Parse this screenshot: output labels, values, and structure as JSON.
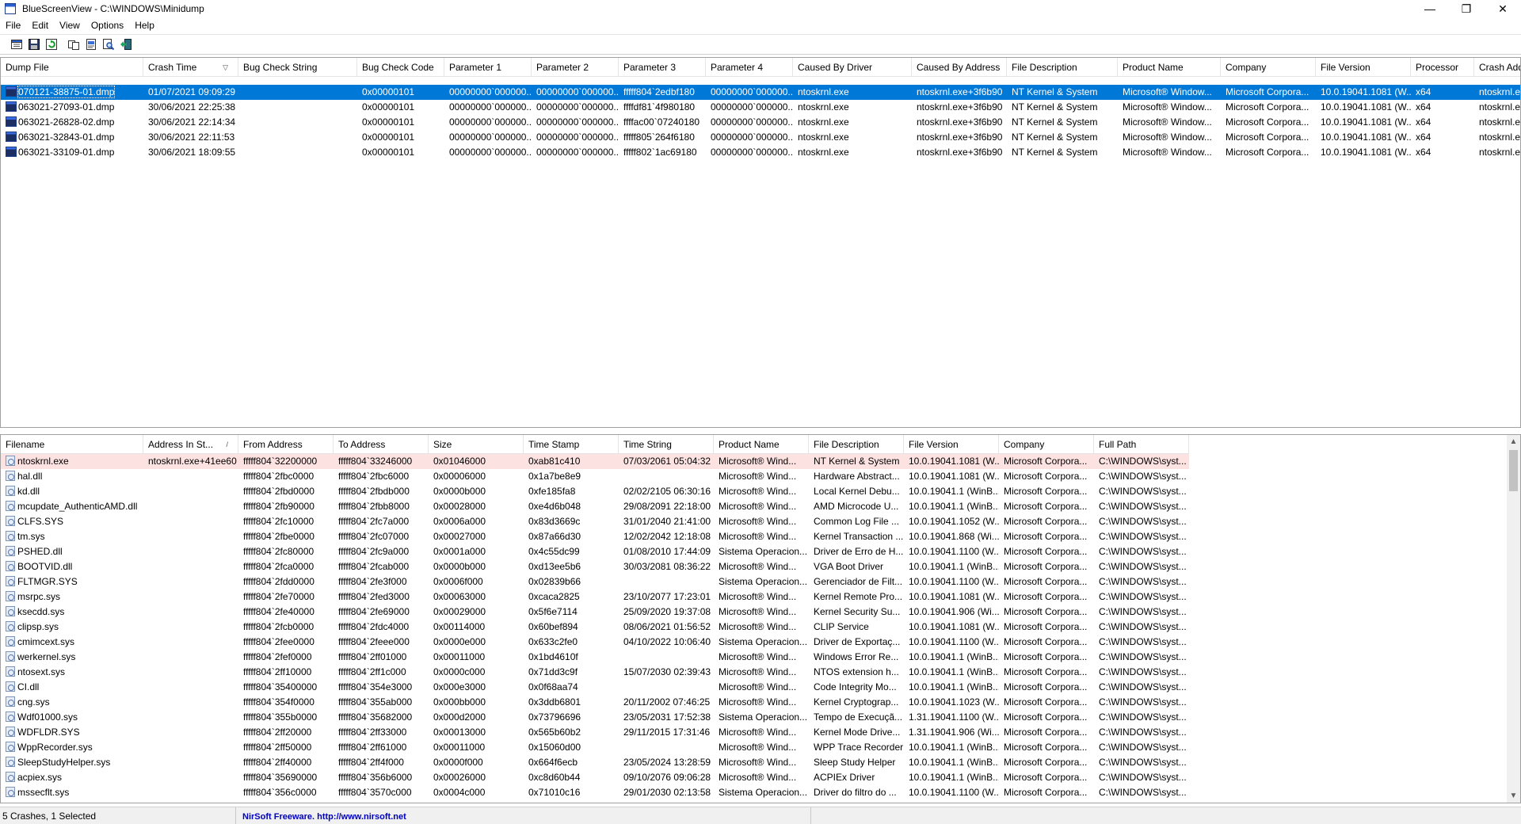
{
  "window": {
    "title": "BlueScreenView  -  C:\\WINDOWS\\Minidump",
    "minimize_glyph": "—",
    "maximize_glyph": "❐",
    "close_glyph": "✕"
  },
  "menu": [
    "File",
    "Edit",
    "View",
    "Options",
    "Help"
  ],
  "toolbar": [
    "properties-icon",
    "save-icon",
    "refresh-icon",
    "copy-icon",
    "html-report-icon",
    "find-icon",
    "exit-icon"
  ],
  "upper": {
    "columns": [
      "Dump File",
      "Crash Time",
      "Bug Check String",
      "Bug Check Code",
      "Parameter 1",
      "Parameter 2",
      "Parameter 3",
      "Parameter 4",
      "Caused By Driver",
      "Caused By Address",
      "File Description",
      "Product Name",
      "Company",
      "File Version",
      "Processor",
      "Crash Add"
    ],
    "sort_glyph": "▽",
    "rows": [
      [
        "070121-38875-01.dmp",
        "01/07/2021 09:09:29",
        "",
        "0x00000101",
        "00000000`000000...",
        "00000000`000000...",
        "fffff804`2edbf180",
        "00000000`000000...",
        "ntoskrnl.exe",
        "ntoskrnl.exe+3f6b90",
        "NT Kernel & System",
        "Microsoft® Window...",
        "Microsoft Corpora...",
        "10.0.19041.1081 (W...",
        "x64",
        "ntoskrnl.e"
      ],
      [
        "063021-27093-01.dmp",
        "30/06/2021 22:25:38",
        "",
        "0x00000101",
        "00000000`000000...",
        "00000000`000000...",
        "ffffdf81`4f980180",
        "00000000`000000...",
        "ntoskrnl.exe",
        "ntoskrnl.exe+3f6b90",
        "NT Kernel & System",
        "Microsoft® Window...",
        "Microsoft Corpora...",
        "10.0.19041.1081 (W...",
        "x64",
        "ntoskrnl.e"
      ],
      [
        "063021-26828-02.dmp",
        "30/06/2021 22:14:34",
        "",
        "0x00000101",
        "00000000`000000...",
        "00000000`000000...",
        "ffffac00`07240180",
        "00000000`000000...",
        "ntoskrnl.exe",
        "ntoskrnl.exe+3f6b90",
        "NT Kernel & System",
        "Microsoft® Window...",
        "Microsoft Corpora...",
        "10.0.19041.1081 (W...",
        "x64",
        "ntoskrnl.e"
      ],
      [
        "063021-32843-01.dmp",
        "30/06/2021 22:11:53",
        "",
        "0x00000101",
        "00000000`000000...",
        "00000000`000000...",
        "fffff805`264f6180",
        "00000000`000000...",
        "ntoskrnl.exe",
        "ntoskrnl.exe+3f6b90",
        "NT Kernel & System",
        "Microsoft® Window...",
        "Microsoft Corpora...",
        "10.0.19041.1081 (W...",
        "x64",
        "ntoskrnl.e"
      ],
      [
        "063021-33109-01.dmp",
        "30/06/2021 18:09:55",
        "",
        "0x00000101",
        "00000000`000000...",
        "00000000`000000...",
        "fffff802`1ac69180",
        "00000000`000000...",
        "ntoskrnl.exe",
        "ntoskrnl.exe+3f6b90",
        "NT Kernel & System",
        "Microsoft® Window...",
        "Microsoft Corpora...",
        "10.0.19041.1081 (W...",
        "x64",
        "ntoskrnl.e"
      ]
    ]
  },
  "lower": {
    "columns": [
      "Filename",
      "Address In St...",
      "From Address",
      "To Address",
      "Size",
      "Time Stamp",
      "Time String",
      "Product Name",
      "File Description",
      "File Version",
      "Company",
      "Full Path"
    ],
    "sort_glyph": "/",
    "rows": [
      [
        "ntoskrnl.exe",
        "ntoskrnl.exe+41ee60",
        "fffff804`32200000",
        "fffff804`33246000",
        "0x01046000",
        "0xab81c410",
        "07/03/2061 05:04:32",
        "Microsoft® Wind...",
        "NT Kernel & System",
        "10.0.19041.1081 (W...",
        "Microsoft Corpora...",
        "C:\\WINDOWS\\syst..."
      ],
      [
        "hal.dll",
        "",
        "fffff804`2fbc0000",
        "fffff804`2fbc6000",
        "0x00006000",
        "0x1a7be8e9",
        "",
        "Microsoft® Wind...",
        "Hardware Abstract...",
        "10.0.19041.1081 (W...",
        "Microsoft Corpora...",
        "C:\\WINDOWS\\syst..."
      ],
      [
        "kd.dll",
        "",
        "fffff804`2fbd0000",
        "fffff804`2fbdb000",
        "0x0000b000",
        "0xfe185fa8",
        "02/02/2105 06:30:16",
        "Microsoft® Wind...",
        "Local Kernel Debu...",
        "10.0.19041.1 (WinB...",
        "Microsoft Corpora...",
        "C:\\WINDOWS\\syst..."
      ],
      [
        "mcupdate_AuthenticAMD.dll",
        "",
        "fffff804`2fb90000",
        "fffff804`2fbb8000",
        "0x00028000",
        "0xe4d6b048",
        "29/08/2091 22:18:00",
        "Microsoft® Wind...",
        "AMD Microcode U...",
        "10.0.19041.1 (WinB...",
        "Microsoft Corpora...",
        "C:\\WINDOWS\\syst..."
      ],
      [
        "CLFS.SYS",
        "",
        "fffff804`2fc10000",
        "fffff804`2fc7a000",
        "0x0006a000",
        "0x83d3669c",
        "31/01/2040 21:41:00",
        "Microsoft® Wind...",
        "Common Log File ...",
        "10.0.19041.1052 (W...",
        "Microsoft Corpora...",
        "C:\\WINDOWS\\syst..."
      ],
      [
        "tm.sys",
        "",
        "fffff804`2fbe0000",
        "fffff804`2fc07000",
        "0x00027000",
        "0x87a66d30",
        "12/02/2042 12:18:08",
        "Microsoft® Wind...",
        "Kernel Transaction ...",
        "10.0.19041.868 (Wi...",
        "Microsoft Corpora...",
        "C:\\WINDOWS\\syst..."
      ],
      [
        "PSHED.dll",
        "",
        "fffff804`2fc80000",
        "fffff804`2fc9a000",
        "0x0001a000",
        "0x4c55dc99",
        "01/08/2010 17:44:09",
        "Sistema Operacion...",
        "Driver de Erro de H...",
        "10.0.19041.1100 (W...",
        "Microsoft Corpora...",
        "C:\\WINDOWS\\syst..."
      ],
      [
        "BOOTVID.dll",
        "",
        "fffff804`2fca0000",
        "fffff804`2fcab000",
        "0x0000b000",
        "0xd13ee5b6",
        "30/03/2081 08:36:22",
        "Microsoft® Wind...",
        "VGA Boot Driver",
        "10.0.19041.1 (WinB...",
        "Microsoft Corpora...",
        "C:\\WINDOWS\\syst..."
      ],
      [
        "FLTMGR.SYS",
        "",
        "fffff804`2fdd0000",
        "fffff804`2fe3f000",
        "0x0006f000",
        "0x02839b66",
        "",
        "Sistema Operacion...",
        "Gerenciador de Filt...",
        "10.0.19041.1100 (W...",
        "Microsoft Corpora...",
        "C:\\WINDOWS\\syst..."
      ],
      [
        "msrpc.sys",
        "",
        "fffff804`2fe70000",
        "fffff804`2fed3000",
        "0x00063000",
        "0xcaca2825",
        "23/10/2077 17:23:01",
        "Microsoft® Wind...",
        "Kernel Remote Pro...",
        "10.0.19041.1081 (W...",
        "Microsoft Corpora...",
        "C:\\WINDOWS\\syst..."
      ],
      [
        "ksecdd.sys",
        "",
        "fffff804`2fe40000",
        "fffff804`2fe69000",
        "0x00029000",
        "0x5f6e7114",
        "25/09/2020 19:37:08",
        "Microsoft® Wind...",
        "Kernel Security Su...",
        "10.0.19041.906 (Wi...",
        "Microsoft Corpora...",
        "C:\\WINDOWS\\syst..."
      ],
      [
        "clipsp.sys",
        "",
        "fffff804`2fcb0000",
        "fffff804`2fdc4000",
        "0x00114000",
        "0x60bef894",
        "08/06/2021 01:56:52",
        "Microsoft® Wind...",
        "CLIP Service",
        "10.0.19041.1081 (W...",
        "Microsoft Corpora...",
        "C:\\WINDOWS\\syst..."
      ],
      [
        "cmimcext.sys",
        "",
        "fffff804`2fee0000",
        "fffff804`2feee000",
        "0x0000e000",
        "0x633c2fe0",
        "04/10/2022 10:06:40",
        "Sistema Operacion...",
        "Driver de Exportaç...",
        "10.0.19041.1100 (W...",
        "Microsoft Corpora...",
        "C:\\WINDOWS\\syst..."
      ],
      [
        "werkernel.sys",
        "",
        "fffff804`2fef0000",
        "fffff804`2ff01000",
        "0x00011000",
        "0x1bd4610f",
        "",
        "Microsoft® Wind...",
        "Windows Error Re...",
        "10.0.19041.1 (WinB...",
        "Microsoft Corpora...",
        "C:\\WINDOWS\\syst..."
      ],
      [
        "ntosext.sys",
        "",
        "fffff804`2ff10000",
        "fffff804`2ff1c000",
        "0x0000c000",
        "0x71dd3c9f",
        "15/07/2030 02:39:43",
        "Microsoft® Wind...",
        "NTOS extension h...",
        "10.0.19041.1 (WinB...",
        "Microsoft Corpora...",
        "C:\\WINDOWS\\syst..."
      ],
      [
        "CI.dll",
        "",
        "fffff804`35400000",
        "fffff804`354e3000",
        "0x000e3000",
        "0x0f68aa74",
        "",
        "Microsoft® Wind...",
        "Code Integrity Mo...",
        "10.0.19041.1 (WinB...",
        "Microsoft Corpora...",
        "C:\\WINDOWS\\syst..."
      ],
      [
        "cng.sys",
        "",
        "fffff804`354f0000",
        "fffff804`355ab000",
        "0x000bb000",
        "0x3ddb6801",
        "20/11/2002 07:46:25",
        "Microsoft® Wind...",
        "Kernel Cryptograp...",
        "10.0.19041.1023 (W...",
        "Microsoft Corpora...",
        "C:\\WINDOWS\\syst..."
      ],
      [
        "Wdf01000.sys",
        "",
        "fffff804`355b0000",
        "fffff804`35682000",
        "0x000d2000",
        "0x73796696",
        "23/05/2031 17:52:38",
        "Sistema Operacion...",
        "Tempo de Execuçã...",
        "1.31.19041.1100 (W...",
        "Microsoft Corpora...",
        "C:\\WINDOWS\\syst..."
      ],
      [
        "WDFLDR.SYS",
        "",
        "fffff804`2ff20000",
        "fffff804`2ff33000",
        "0x00013000",
        "0x565b60b2",
        "29/11/2015 17:31:46",
        "Microsoft® Wind...",
        "Kernel Mode Drive...",
        "1.31.19041.906 (Wi...",
        "Microsoft Corpora...",
        "C:\\WINDOWS\\syst..."
      ],
      [
        "WppRecorder.sys",
        "",
        "fffff804`2ff50000",
        "fffff804`2ff61000",
        "0x00011000",
        "0x15060d00",
        "",
        "Microsoft® Wind...",
        "WPP Trace Recorder",
        "10.0.19041.1 (WinB...",
        "Microsoft Corpora...",
        "C:\\WINDOWS\\syst..."
      ],
      [
        "SleepStudyHelper.sys",
        "",
        "fffff804`2ff40000",
        "fffff804`2ff4f000",
        "0x0000f000",
        "0x664f6ecb",
        "23/05/2024 13:28:59",
        "Microsoft® Wind...",
        "Sleep Study Helper",
        "10.0.19041.1 (WinB...",
        "Microsoft Corpora...",
        "C:\\WINDOWS\\syst..."
      ],
      [
        "acpiex.sys",
        "",
        "fffff804`35690000",
        "fffff804`356b6000",
        "0x00026000",
        "0xc8d60b44",
        "09/10/2076 09:06:28",
        "Microsoft® Wind...",
        "ACPIEx Driver",
        "10.0.19041.1 (WinB...",
        "Microsoft Corpora...",
        "C:\\WINDOWS\\syst..."
      ],
      [
        "mssecflt.sys",
        "",
        "fffff804`356c0000",
        "fffff804`3570c000",
        "0x0004c000",
        "0x71010c16",
        "29/01/2030 02:13:58",
        "Sistema Operacion...",
        "Driver do filtro do ...",
        "10.0.19041.1100 (W...",
        "Microsoft Corpora...",
        "C:\\WINDOWS\\syst..."
      ]
    ]
  },
  "status": {
    "count": "5 Crashes, 1 Selected",
    "freeware": "NirSoft Freeware.  http://www.nirsoft.net"
  },
  "colors": {
    "selection": "#0078d7",
    "highlight_row": "#fde2e2",
    "link": "#0000c0"
  }
}
